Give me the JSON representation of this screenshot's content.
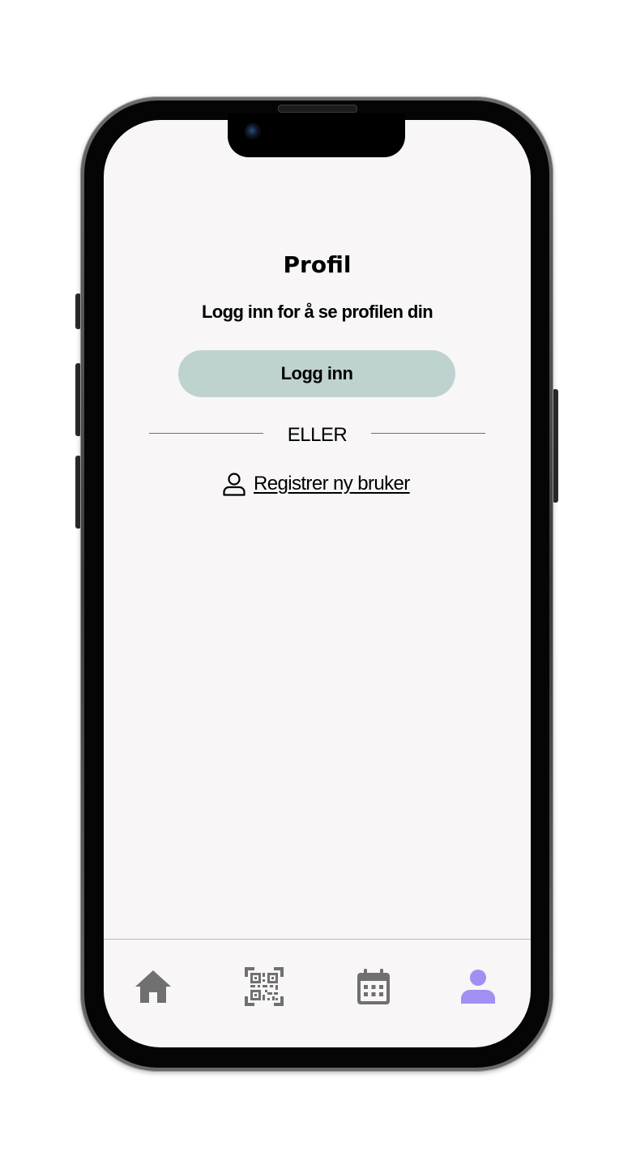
{
  "profile": {
    "title": "Profil",
    "subtitle": "Logg inn for å se profilen din",
    "login_button_label": "Logg inn",
    "divider_label": "ELLER",
    "register_link_label": "Registrer ny bruker",
    "register_icon": "user-outline-icon"
  },
  "colors": {
    "screen_background": "#f8f6f7",
    "login_button_background": "#bed3cf",
    "nav_icon_inactive": "#707070",
    "nav_icon_active": "#a38ef2"
  },
  "bottom_nav": {
    "items": [
      {
        "id": "home",
        "icon": "home-icon",
        "active": false
      },
      {
        "id": "scan",
        "icon": "qr-code-icon",
        "active": false
      },
      {
        "id": "calendar",
        "icon": "calendar-icon",
        "active": false
      },
      {
        "id": "profile",
        "icon": "person-icon",
        "active": true
      }
    ]
  }
}
